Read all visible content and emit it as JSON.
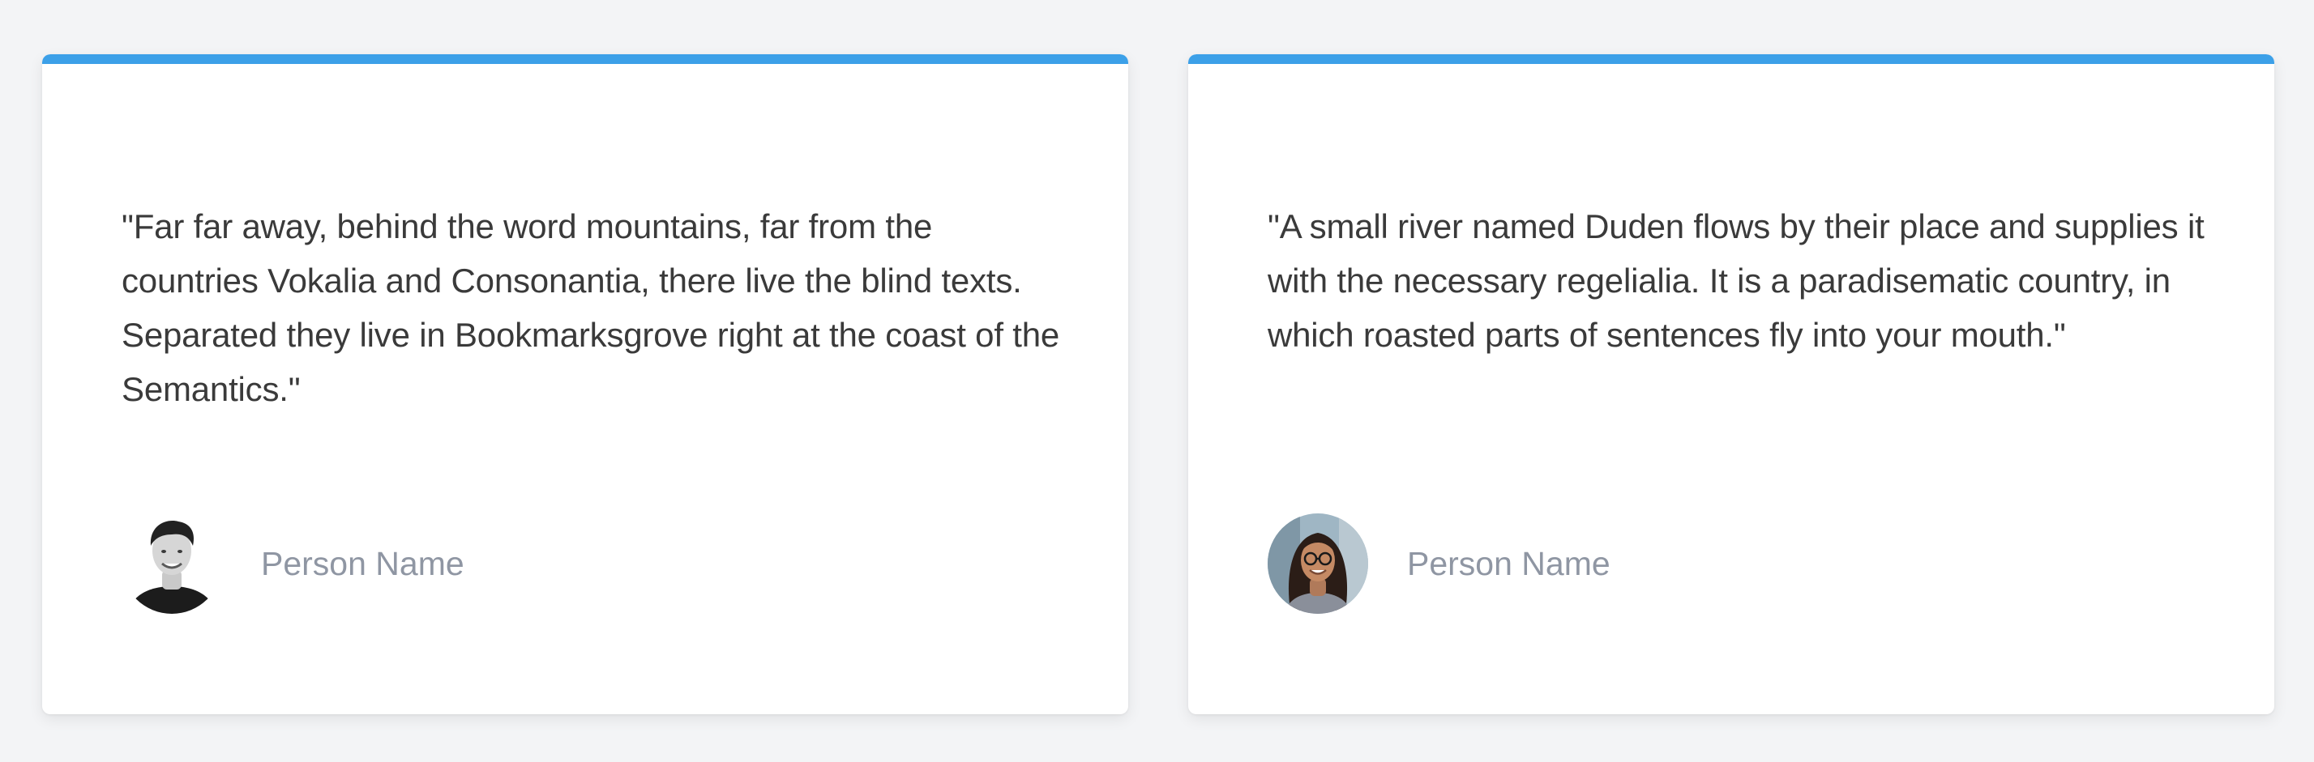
{
  "testimonials": [
    {
      "quote": "\"Far far away, behind the word mountains, far from the countries Vokalia and Consonantia, there live the blind texts. Separated they live in Bookmarksgrove right at the coast of the Semantics.\"",
      "name": "Person Name",
      "avatar_icon": "person-avatar-man"
    },
    {
      "quote": "\"A small river named Duden flows by their place and supplies it with the necessary regelialia. It is a paradisematic country, in which roasted parts of sentences fly into your mouth.\"",
      "name": "Person Name",
      "avatar_icon": "person-avatar-woman"
    }
  ],
  "colors": {
    "accent": "#3ca0e8",
    "quote_text": "#3a3a3a",
    "name_text": "#8f96a3",
    "background": "#f3f4f6"
  }
}
